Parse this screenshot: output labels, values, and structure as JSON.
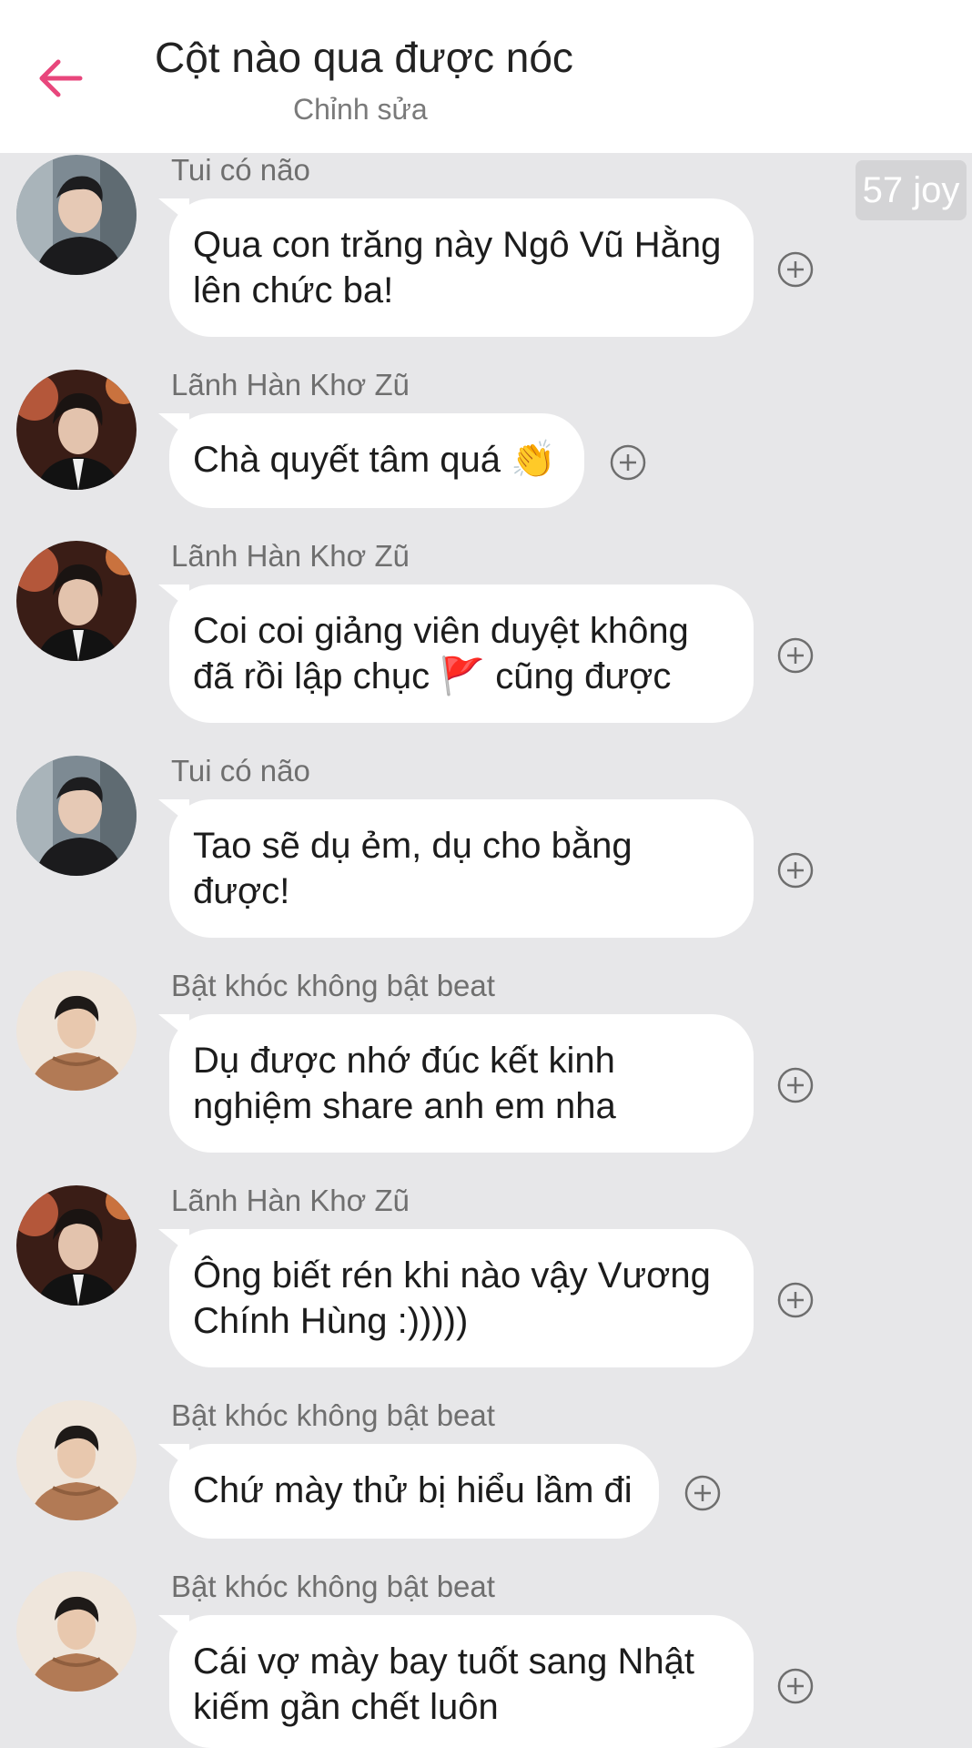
{
  "header": {
    "title": "Cột nào qua được nóc",
    "subtitle": "Chỉnh sửa",
    "back_icon": "arrow-left-icon",
    "accent_color": "#e8467c"
  },
  "joy_badge": "57 joy",
  "messages": [
    {
      "author": "Tui có não",
      "avatar": "avatar-tui-co-nao",
      "lines": [
        "Qua con trăng này Ngô Vũ Hằng",
        "lên chức ba!"
      ]
    },
    {
      "author": "Lãnh Hàn Khơ Zũ",
      "avatar": "avatar-lanh-han-kho-zu",
      "lines": [
        "Chà quyết tâm quá",
        ""
      ],
      "emoji": "clapping-hands-icon"
    },
    {
      "author": "Lãnh Hàn Khơ Zũ",
      "avatar": "avatar-lanh-han-kho-zu",
      "lines": [
        "Coi coi giảng viên duyệt không",
        "đã rồi lập chục",
        "cũng được"
      ],
      "emoji": "red-flag-icon"
    },
    {
      "author": "Tui có não",
      "avatar": "avatar-tui-co-nao",
      "lines": [
        "Tao sẽ dụ ẻm, dụ cho bằng",
        "được!"
      ]
    },
    {
      "author": "Bật khóc không bật beat",
      "avatar": "avatar-bat-khoc",
      "lines": [
        "Dụ được nhớ đúc kết kinh",
        "nghiệm share anh em nha"
      ]
    },
    {
      "author": "Lãnh Hàn Khơ Zũ",
      "avatar": "avatar-lanh-han-kho-zu",
      "lines": [
        "Ông biết rén khi nào vậy Vương",
        "Chính Hùng :)))))"
      ]
    },
    {
      "author": "Bật khóc không bật beat",
      "avatar": "avatar-bat-khoc",
      "lines": [
        "Chứ mày thử bị hiểu lầm đi"
      ]
    },
    {
      "author": "Bật khóc không bật beat",
      "avatar": "avatar-bat-khoc",
      "lines": [
        "Cái vợ mày bay tuốt sang Nhật",
        "kiếm gần chết luôn"
      ]
    }
  ],
  "reaction_icon": "add-reaction-icon"
}
